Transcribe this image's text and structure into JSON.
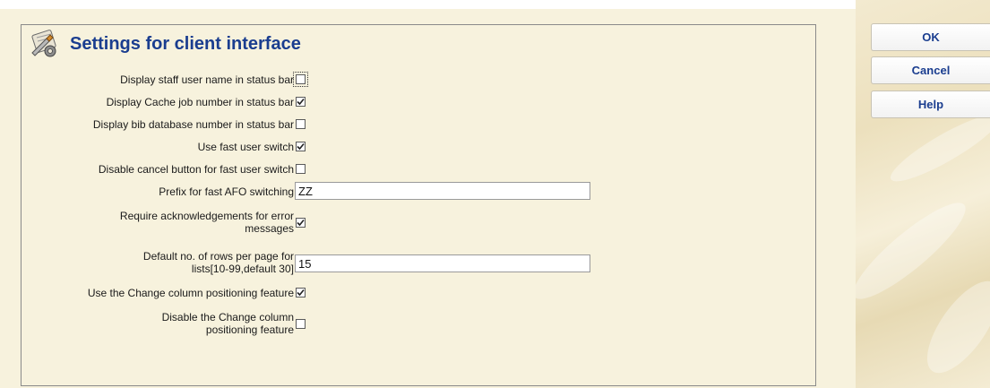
{
  "header": {
    "title": "Settings for client interface",
    "icon": "settings-tools-icon"
  },
  "settings": [
    {
      "label": "Display staff user name in status bar",
      "type": "checkbox",
      "checked": false
    },
    {
      "label": "Display Cache job number in status bar",
      "type": "checkbox",
      "checked": true
    },
    {
      "label": "Display bib database number in status bar",
      "type": "checkbox",
      "checked": false
    },
    {
      "label": "Use fast user switch",
      "type": "checkbox",
      "checked": true
    },
    {
      "label": "Disable cancel button for fast user switch",
      "type": "checkbox",
      "checked": false
    },
    {
      "label": "Prefix for fast AFO switching",
      "type": "text",
      "value": "ZZ"
    },
    {
      "label": "Require acknowledgements for error messages",
      "type": "checkbox",
      "checked": true
    },
    {
      "label": "Default no. of rows per page for lists[10-99,default 30]",
      "type": "text",
      "value": "15"
    },
    {
      "label": "Use the Change column positioning feature",
      "type": "checkbox",
      "checked": true
    },
    {
      "label": "Disable the Change column positioning feature",
      "type": "checkbox",
      "checked": false
    }
  ],
  "buttons": {
    "ok": "OK",
    "cancel": "Cancel",
    "help": "Help"
  },
  "colors": {
    "title": "#1a3d8f",
    "button_text": "#1a3d8f",
    "background": "#f7f2dd"
  }
}
